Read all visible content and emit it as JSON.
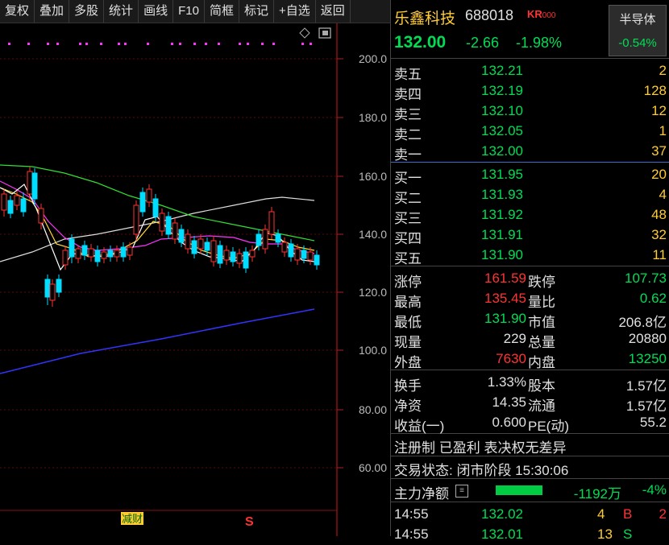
{
  "toolbar": [
    "复权",
    "叠加",
    "多股",
    "统计",
    "画线",
    "F10",
    "简框",
    "标记",
    "+自选",
    "返回"
  ],
  "stock": {
    "name": "乐鑫科技",
    "code": "688018",
    "badge": "K",
    "badge2": "R",
    "badge_small": "000",
    "price": "132.00",
    "change": "-2.66",
    "change_pct": "-1.98%"
  },
  "sector": {
    "name": "半导体",
    "change": "-0.54%"
  },
  "sell": [
    {
      "label": "卖五",
      "price": "132.21",
      "vol": "2"
    },
    {
      "label": "卖四",
      "price": "132.19",
      "vol": "128"
    },
    {
      "label": "卖三",
      "price": "132.10",
      "vol": "12"
    },
    {
      "label": "卖二",
      "price": "132.05",
      "vol": "1"
    },
    {
      "label": "卖一",
      "price": "132.00",
      "vol": "37"
    }
  ],
  "buy": [
    {
      "label": "买一",
      "price": "131.95",
      "vol": "20"
    },
    {
      "label": "买二",
      "price": "131.93",
      "vol": "4"
    },
    {
      "label": "买三",
      "price": "131.92",
      "vol": "48"
    },
    {
      "label": "买四",
      "price": "131.91",
      "vol": "32"
    },
    {
      "label": "买五",
      "price": "131.90",
      "vol": "11"
    }
  ],
  "stats1": [
    {
      "l1": "涨停",
      "v1": "161.59",
      "c1": "red",
      "l2": "跌停",
      "v2": "107.73",
      "c2": "grn"
    },
    {
      "l1": "最高",
      "v1": "135.45",
      "c1": "red",
      "l2": "量比",
      "v2": "0.62",
      "c2": "grn"
    },
    {
      "l1": "最低",
      "v1": "131.90",
      "c1": "grn",
      "l2": "市值",
      "v2": "206.8亿",
      "c2": "wht"
    },
    {
      "l1": "现量",
      "v1": "229",
      "c1": "wht",
      "l2": "总量",
      "v2": "20880",
      "c2": "wht"
    },
    {
      "l1": "外盘",
      "v1": "7630",
      "c1": "red",
      "l2": "内盘",
      "v2": "13250",
      "c2": "grn"
    }
  ],
  "stats2": [
    {
      "l1": "换手",
      "v1": "1.33%",
      "l2": "股本",
      "v2": "1.57亿"
    },
    {
      "l1": "净资",
      "v1": "14.35",
      "l2": "流通",
      "v2": "1.57亿"
    },
    {
      "l1": "收益(一)",
      "v1": "0.600",
      "l2": "PE(动)",
      "v2": "55.2"
    }
  ],
  "info": {
    "reg": "注册制 已盈利 表决权无差异",
    "status": "交易状态: 闭市阶段 15:30:06"
  },
  "mainflow": {
    "label": "主力净额",
    "value": "-1192万",
    "pct": "-4%"
  },
  "ticks": [
    {
      "time": "14:55",
      "price": "132.02",
      "vol": "4",
      "side": "B"
    },
    {
      "time": "14:55",
      "price": "132.01",
      "vol": "13",
      "side": "S"
    }
  ],
  "tick_extra": "2",
  "chart": {
    "yticks": [
      "200.0",
      "180.0",
      "160.0",
      "140.0",
      "120.0",
      "100.0",
      "80.00",
      "60.00"
    ],
    "markers": {
      "left": "减财",
      "right": "S"
    },
    "colors": {
      "up": "#ff3333",
      "down": "#00ddff",
      "ma5": "#ffffff",
      "ma10": "#ffdd33",
      "ma20": "#ff33ff",
      "ma60": "#33dd33",
      "ma120": "#dddddd",
      "ma250": "#3333ff"
    }
  }
}
